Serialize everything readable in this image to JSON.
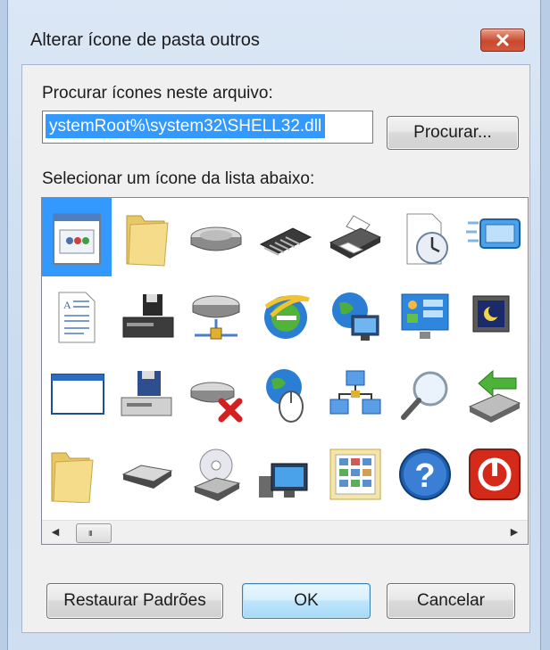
{
  "window": {
    "title": "Alterar ícone de pasta outros"
  },
  "dialog": {
    "file_label": "Procurar ícones neste arquivo:",
    "file_value": "ystemRoot%\\system32\\SHELL32.dll",
    "browse_button": "Procurar...",
    "list_label": "Selecionar um ícone da lista abaixo:",
    "icons": [
      "application-window-icon",
      "folder-icon",
      "hard-drive-icon",
      "memory-chip-icon",
      "printer-icon",
      "clock-document-icon",
      "display-icon",
      "partial-icon",
      "text-document-icon",
      "floppy-printer-icon",
      "network-drive-icon",
      "internet-explorer-icon",
      "network-globe-icon",
      "control-panel-icon",
      "monitor-moon-icon",
      "shortcut-arrow-icon",
      "empty-window-icon",
      "floppy-computer-icon",
      "disconnected-drive-icon",
      "globe-mouse-icon",
      "network-computers-icon",
      "magnifier-icon",
      "green-arrow-drive-icon",
      "clock-overlay-icon",
      "folder-icon",
      "disk-drive-icon",
      "cd-drive-icon",
      "computer-monitor-icon",
      "calendar-grid-icon",
      "help-icon",
      "power-icon",
      "partial-icon"
    ],
    "scroll_grip": "III",
    "buttons": {
      "restore": "Restaurar Padrões",
      "ok": "OK",
      "cancel": "Cancelar"
    }
  }
}
